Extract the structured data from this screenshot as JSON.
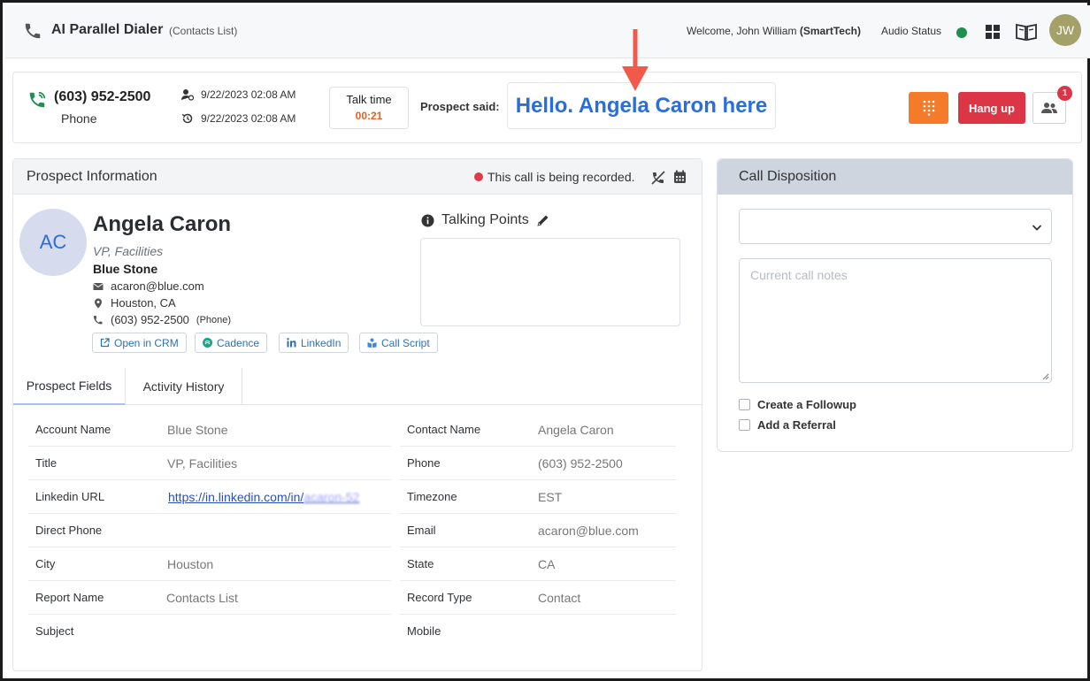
{
  "header": {
    "app_title": "AI Parallel Dialer",
    "app_subtitle": "(Contacts List)",
    "welcome_prefix": "Welcome, John William",
    "welcome_org": "(SmartTech)",
    "audio_status_label": "Audio Status",
    "audio_status_color": "#1e8f4e",
    "user_initials": "JW",
    "avatar_color": "#a3a06a"
  },
  "call": {
    "number": "(603) 952-2500",
    "type": "Phone",
    "time_1": "9/22/2023 02:08 AM",
    "time_2": "9/22/2023 02:08 AM",
    "talk_label": "Talk time",
    "talk_time": "00:21",
    "prospect_label": "Prospect said:",
    "prospect_text": "Hello. Angela Caron here",
    "hangup_label": "Hang up",
    "notification_count": "1",
    "colors": {
      "dialpad": "#f47b2a",
      "hangup": "#dc3545",
      "badge": "#dc3545",
      "accent_green": "#1e8f4e",
      "annotation_arrow": "#f15a4a"
    }
  },
  "prospect_panel": {
    "title": "Prospect Information",
    "recording_text": "This call is being recorded.",
    "recording_dot_color": "#e03a4a",
    "initials": "AC",
    "avatar_bg": "#d7dbee",
    "avatar_fg": "#2b6dd9",
    "name": "Angela Caron",
    "title_role": "VP, Facilities",
    "company": "Blue Stone",
    "email": "acaron@blue.com",
    "location": "Houston, CA",
    "phone": "(603) 952-2500",
    "phone_type": "(Phone)",
    "buttons": [
      "Open in CRM",
      "Cadence",
      "LinkedIn",
      "Call Script"
    ],
    "talking_points_title": "Talking Points",
    "tabs": [
      "Prospect Fields",
      "Activity History"
    ]
  },
  "fields": {
    "left": [
      {
        "label": "Account Name",
        "value": "Blue Stone"
      },
      {
        "label": "Title",
        "value": "VP, Facilities"
      },
      {
        "label": "Linkedin URL",
        "value": "https://in.linkedin.com/in/",
        "value_blurred": "acaron-52"
      },
      {
        "label": "Direct Phone",
        "value": ""
      },
      {
        "label": "City",
        "value": "Houston"
      },
      {
        "label": "Report Name",
        "value": "Contacts List"
      },
      {
        "label": "Subject",
        "value": ""
      }
    ],
    "right": [
      {
        "label": "Contact Name",
        "value": "Angela Caron"
      },
      {
        "label": "Phone",
        "value": "(603) 952-2500"
      },
      {
        "label": "Timezone",
        "value": "EST"
      },
      {
        "label": "Email",
        "value": "acaron@blue.com"
      },
      {
        "label": "State",
        "value": "CA"
      },
      {
        "label": "Record Type",
        "value": "Contact"
      },
      {
        "label": "Mobile",
        "value": ""
      }
    ]
  },
  "disposition": {
    "title": "Call Disposition",
    "select_value": "",
    "notes_placeholder": "Current call notes",
    "checkbox_1": "Create a Followup",
    "checkbox_2": "Add a Referral"
  }
}
